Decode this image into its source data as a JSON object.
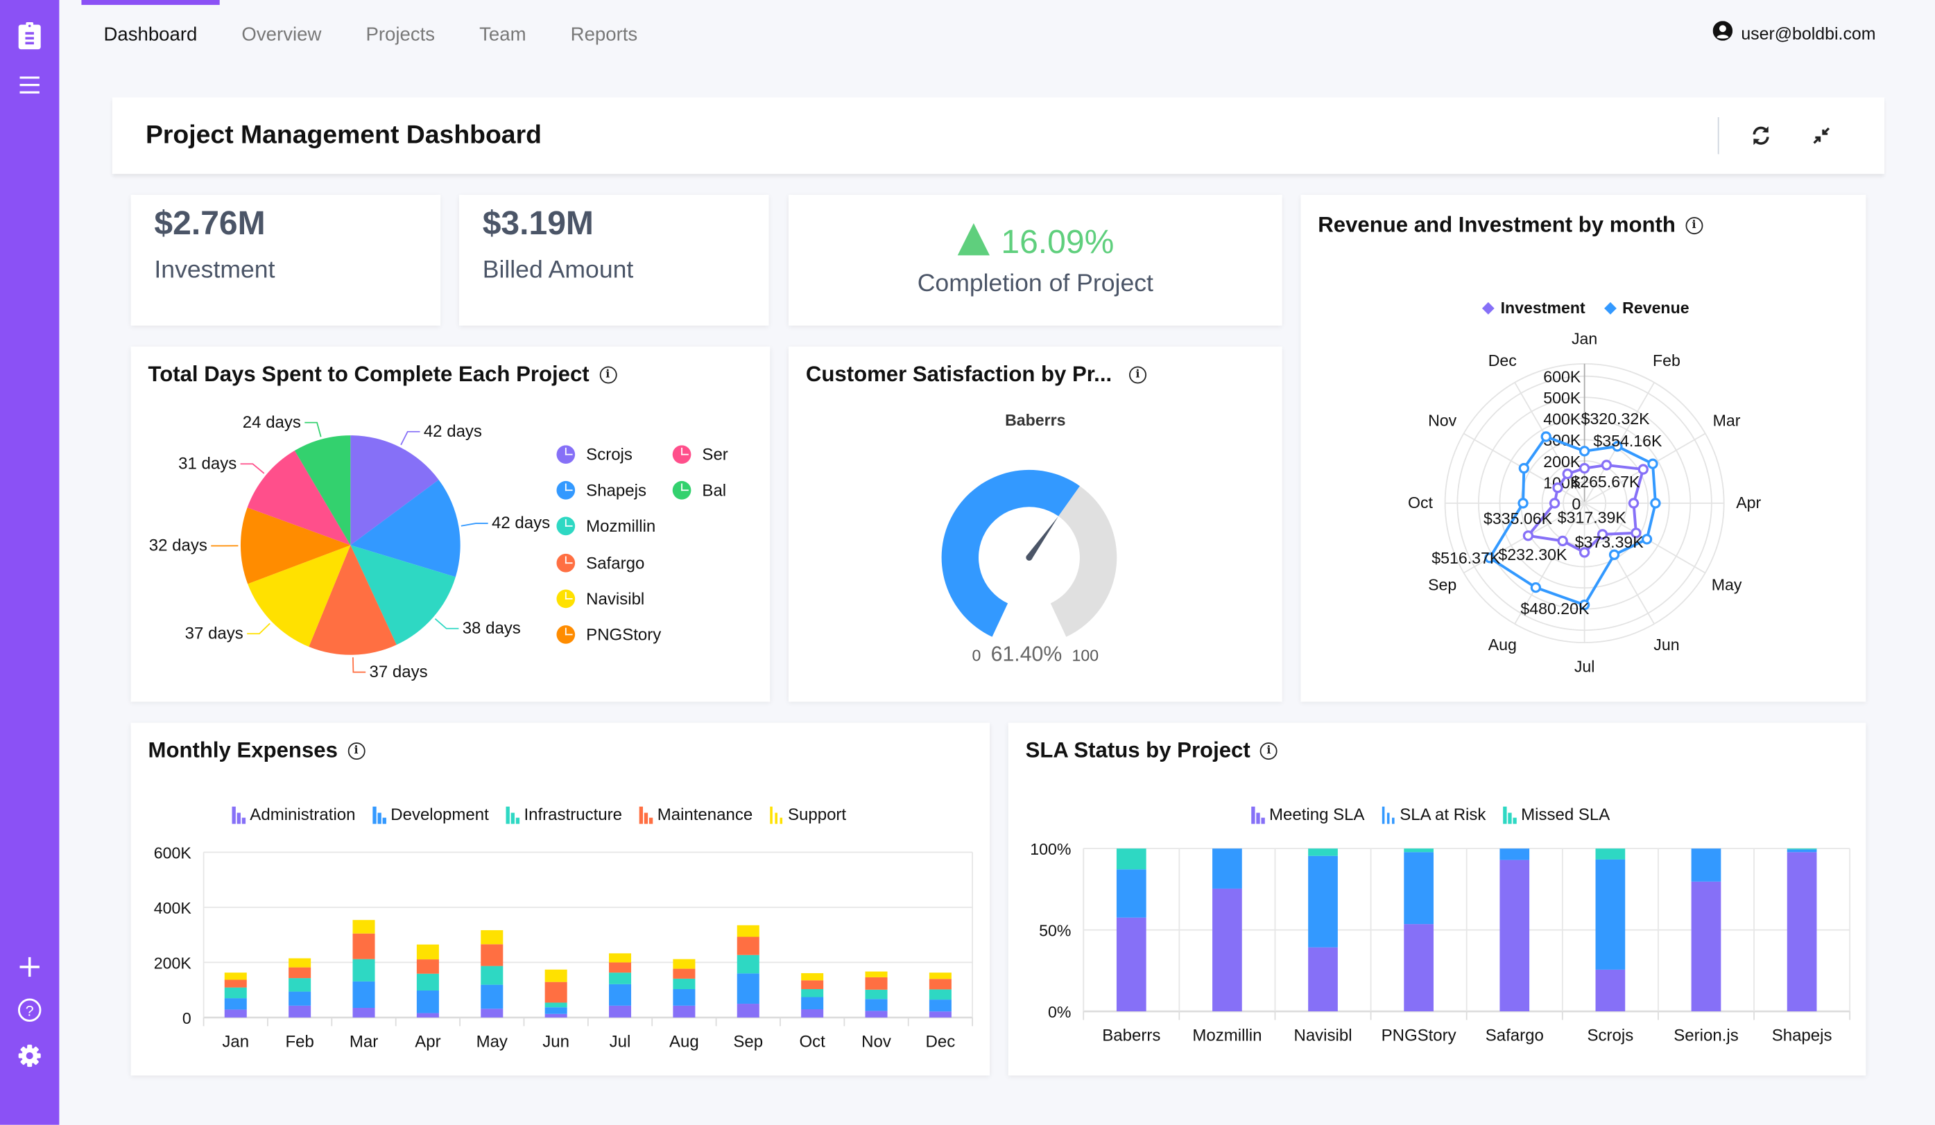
{
  "nav": {
    "tabs": [
      "Dashboard",
      "Overview",
      "Projects",
      "Team",
      "Reports"
    ],
    "active_tab": "Dashboard",
    "user": "user@boldbi.com"
  },
  "sidebar": {
    "top_icons": [
      "clipboard-icon",
      "menu-icon"
    ],
    "bottom_icons": [
      "add-icon",
      "help-icon",
      "settings-icon"
    ]
  },
  "header": {
    "title": "Project Management Dashboard",
    "actions": [
      "refresh-icon",
      "collapse-icon"
    ]
  },
  "colors": {
    "brand": "#8b51f5",
    "kpi_text": "#4b5567",
    "positive": "#5fcf7d",
    "admin": "#8670f7",
    "development": "#3399ff",
    "infrastructure": "#2ed8c3",
    "maintenance": "#ff6f42",
    "support": "#ffe100",
    "gauge_track": "#e0e0e0"
  },
  "kpis": [
    {
      "value": "$2.76M",
      "label": "Investment"
    },
    {
      "value": "$3.19M",
      "label": "Billed Amount"
    },
    {
      "value": "16.09%",
      "label": "Completion of Project",
      "trend": "up"
    }
  ],
  "pie": {
    "title": "Total Days Spent to Complete Each Project",
    "legend_visible": [
      "Scrojs",
      "Shapejs",
      "Mozmillin",
      "Safargo",
      "Navisibl",
      "PNGStory",
      "Ser",
      "Bal"
    ]
  },
  "gauge": {
    "title": "Customer Satisfaction by Pr...",
    "subtitle": "Baberrs",
    "min_label": "0",
    "max_label": "100",
    "value_label": "61.40%",
    "value": 61.4
  },
  "radar": {
    "title": "Revenue and Investment by month"
  },
  "expenses": {
    "title": "Monthly Expenses"
  },
  "sla": {
    "title": "SLA Status by Project"
  },
  "chart_data": [
    {
      "id": "pie",
      "type": "pie",
      "title": "Total Days Spent to Complete Each Project",
      "categories": [
        "Scrojs",
        "Shapejs",
        "Mozmillin",
        "Safargo",
        "Navisibl",
        "PNGStory",
        "Serion.js",
        "Baberrs"
      ],
      "values": [
        42,
        42,
        38,
        37,
        37,
        32,
        31,
        24
      ],
      "labels": [
        "42 days",
        "42 days",
        "38 days",
        "37 days",
        "37 days",
        "32 days",
        "31 days",
        "24 days"
      ],
      "colors": [
        "#8670f7",
        "#3399ff",
        "#2ed8c3",
        "#ff6f42",
        "#ffe100",
        "#ff8c00",
        "#ff4f8b",
        "#33d16e"
      ],
      "legend": "right"
    },
    {
      "id": "gauge",
      "type": "gauge",
      "title": "Customer Satisfaction by Pr...",
      "subtitle": "Baberrs",
      "value": 61.4,
      "range": [
        0,
        100
      ]
    },
    {
      "id": "radar",
      "type": "line",
      "subtype": "polar",
      "title": "Revenue and Investment by month",
      "categories": [
        "Jan",
        "Feb",
        "Mar",
        "Apr",
        "May",
        "Jun",
        "Jul",
        "Aug",
        "Sep",
        "Oct",
        "Nov",
        "Dec"
      ],
      "series": [
        {
          "name": "Investment",
          "color": "#8670f7",
          "values": [
            165,
            208,
            320,
            232,
            281,
            170,
            232.3,
            206,
            307,
            141,
            146,
            160
          ]
        },
        {
          "name": "Revenue",
          "color": "#3399ff",
          "values": [
            246,
            310,
            372,
            335,
            340,
            281,
            480.2,
            460,
            516.37,
            290,
            330,
            363
          ]
        }
      ],
      "data_labels": [
        "$320.32K",
        "$354.16K",
        "$265.67K",
        "$317.39K",
        "$373.39K",
        "$232.30K",
        "$480.20K",
        "$516.37K",
        "$335.06K"
      ],
      "radial_ticks": [
        "0",
        "100K",
        "200K",
        "300K",
        "400K",
        "500K",
        "600K"
      ],
      "range": [
        0,
        600
      ],
      "units": "thousands USD",
      "legend": "top"
    },
    {
      "id": "expenses",
      "type": "bar",
      "stacked": true,
      "title": "Monthly Expenses",
      "categories": [
        "Jan",
        "Feb",
        "Mar",
        "Apr",
        "May",
        "Jun",
        "Jul",
        "Aug",
        "Sep",
        "Oct",
        "Nov",
        "Dec"
      ],
      "series": [
        {
          "name": "Administration",
          "color": "#8670f7",
          "values": [
            29,
            43,
            35,
            16,
            32,
            13,
            43,
            43,
            50,
            30,
            24,
            22
          ]
        },
        {
          "name": "Development",
          "color": "#3399ff",
          "values": [
            41,
            51,
            96,
            82,
            87,
            24,
            78,
            60,
            110,
            44,
            43,
            43
          ]
        },
        {
          "name": "Infrastructure",
          "color": "#2ed8c3",
          "values": [
            39,
            49,
            81,
            61,
            68,
            17,
            42,
            38,
            67,
            29,
            34,
            37
          ]
        },
        {
          "name": "Maintenance",
          "color": "#ff6f42",
          "values": [
            28,
            39,
            93,
            52,
            79,
            75,
            37,
            36,
            66,
            32,
            45,
            38
          ]
        },
        {
          "name": "Support",
          "color": "#ffe100",
          "values": [
            26,
            33,
            49,
            54,
            51,
            45,
            33,
            35,
            42,
            26,
            21,
            23
          ]
        }
      ],
      "yticks": [
        "0",
        "200K",
        "400K",
        "600K"
      ],
      "ylim": [
        0,
        600
      ],
      "units": "thousands",
      "legend": "top",
      "grid": true
    },
    {
      "id": "sla",
      "type": "bar",
      "stacked": true,
      "percent": true,
      "title": "SLA Status by Project",
      "categories": [
        "Baberrs",
        "Mozmillin",
        "Navisibl",
        "PNGStory",
        "Safargo",
        "Scrojs",
        "Serion.js",
        "Shapejs"
      ],
      "series": [
        {
          "name": "Meeting SLA",
          "color": "#8670f7",
          "values": [
            57.6,
            75.4,
            39.3,
            53.6,
            93.0,
            25.6,
            79.7,
            97.8
          ]
        },
        {
          "name": "SLA at Risk",
          "color": "#3399ff",
          "values": [
            29.6,
            24.6,
            56.2,
            44.2,
            7.0,
            67.7,
            20.3,
            1.6
          ]
        },
        {
          "name": "Missed SLA",
          "color": "#2ed8c3",
          "values": [
            12.8,
            0,
            4.5,
            2.2,
            0,
            6.7,
            0,
            0.6
          ]
        }
      ],
      "yticks": [
        "0%",
        "50%",
        "100%"
      ],
      "ylim": [
        0,
        100
      ],
      "legend": "top",
      "grid": true
    }
  ]
}
